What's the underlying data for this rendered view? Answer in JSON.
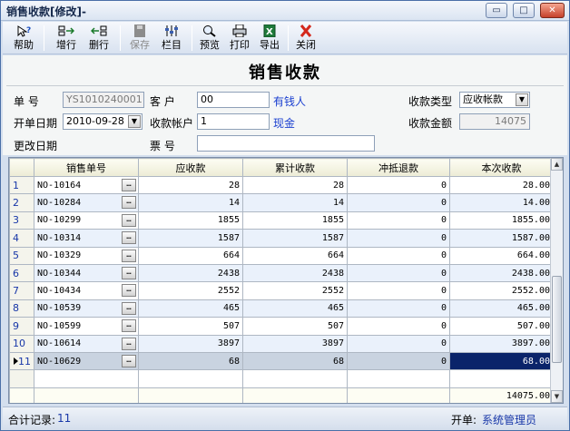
{
  "window": {
    "title": "销售收款[修改]-",
    "buttons": {
      "min": "▭",
      "max": "□",
      "close": "✕"
    }
  },
  "toolbar": {
    "help": "帮助",
    "add_row": "增行",
    "delete_row": "删行",
    "save": "保存",
    "columns": "栏目",
    "preview": "预览",
    "print": "打印",
    "export": "导出",
    "close": "关闭"
  },
  "form": {
    "title": "销售收款",
    "doc_no_label": "单 号",
    "doc_no": "YS1010240001",
    "customer_label": "客 户",
    "customer_code": "00",
    "customer_name": "有钱人",
    "receipt_type_label": "收款类型",
    "receipt_type": "应收帐款",
    "open_date_label": "开单日期",
    "open_date": "2010-09-28",
    "account_label": "收款帐户",
    "account_code": "1",
    "account_name": "现金",
    "amount_label": "收款金额",
    "amount": "14075",
    "change_date_label": "更改日期",
    "ticket_label": "票 号",
    "ticket_no": ""
  },
  "grid": {
    "columns": [
      "销售单号",
      "应收款",
      "累计收款",
      "冲抵退款",
      "本次收款"
    ],
    "rows": [
      {
        "n": "1",
        "code": "NO-10164",
        "due": "28",
        "paid": "28",
        "offset": "0",
        "this": "28.00"
      },
      {
        "n": "2",
        "code": "NO-10284",
        "due": "14",
        "paid": "14",
        "offset": "0",
        "this": "14.00"
      },
      {
        "n": "3",
        "code": "NO-10299",
        "due": "1855",
        "paid": "1855",
        "offset": "0",
        "this": "1855.00"
      },
      {
        "n": "4",
        "code": "NO-10314",
        "due": "1587",
        "paid": "1587",
        "offset": "0",
        "this": "1587.00"
      },
      {
        "n": "5",
        "code": "NO-10329",
        "due": "664",
        "paid": "664",
        "offset": "0",
        "this": "664.00"
      },
      {
        "n": "6",
        "code": "NO-10344",
        "due": "2438",
        "paid": "2438",
        "offset": "0",
        "this": "2438.00"
      },
      {
        "n": "7",
        "code": "NO-10434",
        "due": "2552",
        "paid": "2552",
        "offset": "0",
        "this": "2552.00"
      },
      {
        "n": "8",
        "code": "NO-10539",
        "due": "465",
        "paid": "465",
        "offset": "0",
        "this": "465.00"
      },
      {
        "n": "9",
        "code": "NO-10599",
        "due": "507",
        "paid": "507",
        "offset": "0",
        "this": "507.00"
      },
      {
        "n": "10",
        "code": "NO-10614",
        "due": "3897",
        "paid": "3897",
        "offset": "0",
        "this": "3897.00"
      },
      {
        "n": "11",
        "code": "NO-10629",
        "due": "68",
        "paid": "68",
        "offset": "0",
        "this": "68.00"
      }
    ],
    "total_this": "14075.00",
    "ellipsis": "…",
    "scroll_up": "▲",
    "scroll_down": "▼"
  },
  "status": {
    "records_label": "合计记录:",
    "records_count": "11",
    "operator_label": "开单:",
    "operator": "系统管理员"
  }
}
